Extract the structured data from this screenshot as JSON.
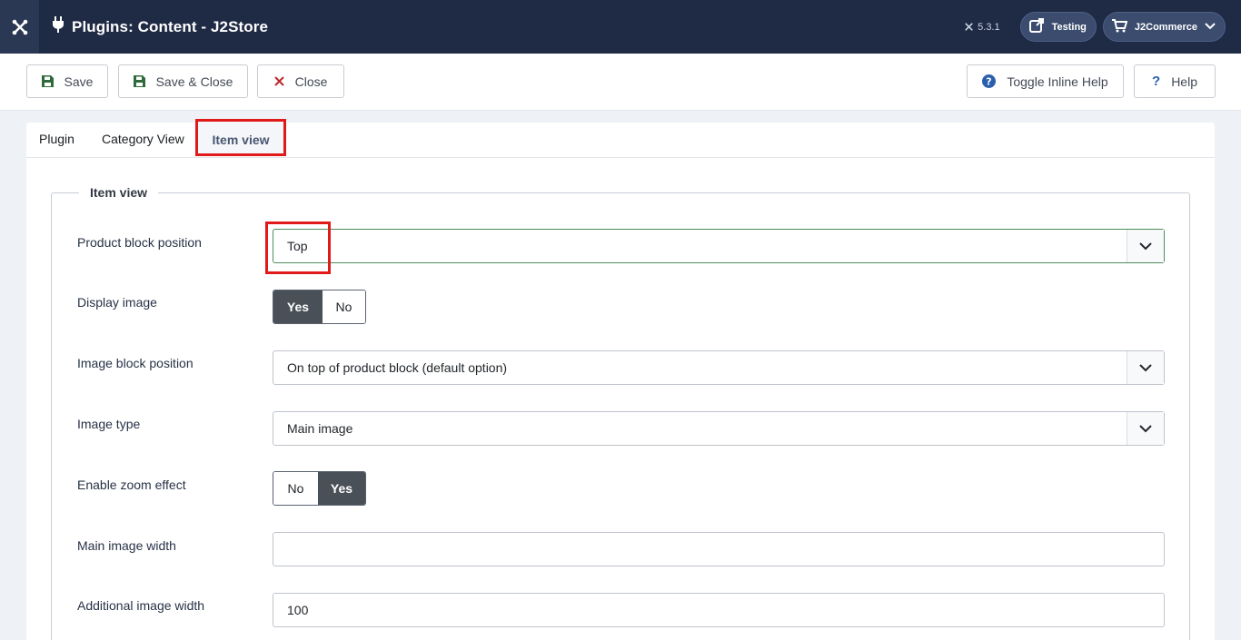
{
  "header": {
    "title": "Plugins: Content - J2Store",
    "version": "5.3.1",
    "site_label": "Testing",
    "user_label": "J2Commerce"
  },
  "toolbar": {
    "save_label": "Save",
    "save_close_label": "Save & Close",
    "close_label": "Close",
    "toggle_help_label": "Toggle Inline Help",
    "help_label": "Help"
  },
  "tabs": [
    {
      "label": "Plugin"
    },
    {
      "label": "Category View"
    },
    {
      "label": "Item view",
      "active": true
    }
  ],
  "fieldset": {
    "legend": "Item view",
    "fields": {
      "product_block_position": {
        "label": "Product block position",
        "value": "Top"
      },
      "display_image": {
        "label": "Display image",
        "options": [
          "Yes",
          "No"
        ],
        "selected": "Yes"
      },
      "image_block_position": {
        "label": "Image block position",
        "value": "On top of product block (default option)"
      },
      "image_type": {
        "label": "Image type",
        "value": "Main image"
      },
      "enable_zoom": {
        "label": "Enable zoom effect",
        "options": [
          "No",
          "Yes"
        ],
        "selected": "Yes"
      },
      "main_image_width": {
        "label": "Main image width",
        "value": ""
      },
      "additional_image_width": {
        "label": "Additional image width",
        "value": "100"
      }
    }
  },
  "colors": {
    "header_bg": "#1f2a44",
    "highlight": "#e01919",
    "toggle_active": "#495057"
  }
}
